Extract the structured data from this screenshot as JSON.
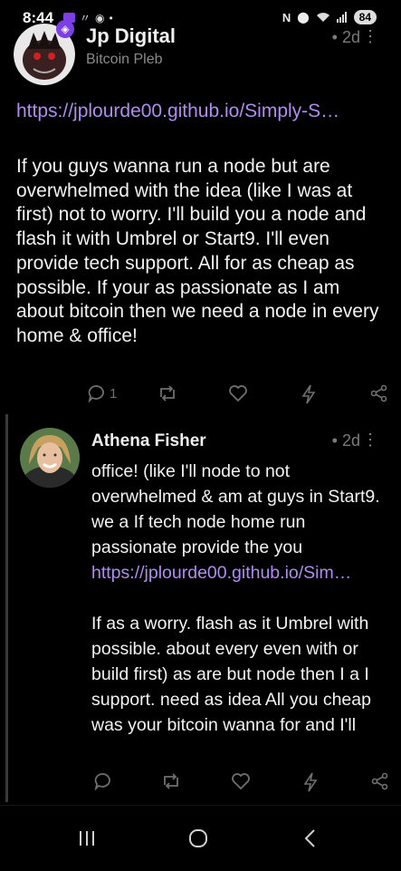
{
  "status_bar": {
    "time": "8:44",
    "battery": "84"
  },
  "post": {
    "author": "Jp Digital",
    "handle": "Bitcoin Pleb",
    "time": "• 2d",
    "link": "https://jplourde00.github.io/Simply-S…",
    "text": "If you guys wanna run a node but are overwhelmed with the idea (like I was at first) not to worry. I'll build you a node and flash it with Umbrel or Start9. I'll even provide tech support. All for as cheap as possible. If your as passionate as I am about bitcoin then we need a node in every home & office!",
    "reply_count": "1",
    "badge_icon": "shield-icon"
  },
  "reply": {
    "author": "Athena Fisher",
    "time": "• 2d",
    "text_top": "office! (like I'll node to not overwhelmed & am at guys in Start9. we a If tech node home run passionate provide the you",
    "link": "https://jplourde00.github.io/Sim…",
    "text_bottom": "If as a worry. flash as it Umbrel with possible. about every even with or build first) as are but node then I a I support. need as idea All you cheap was your bitcoin wanna for and I'll"
  },
  "colors": {
    "background": "#000000",
    "link": "#b08cf0",
    "muted": "#7a7a7a",
    "badge": "#7b3fe4"
  }
}
